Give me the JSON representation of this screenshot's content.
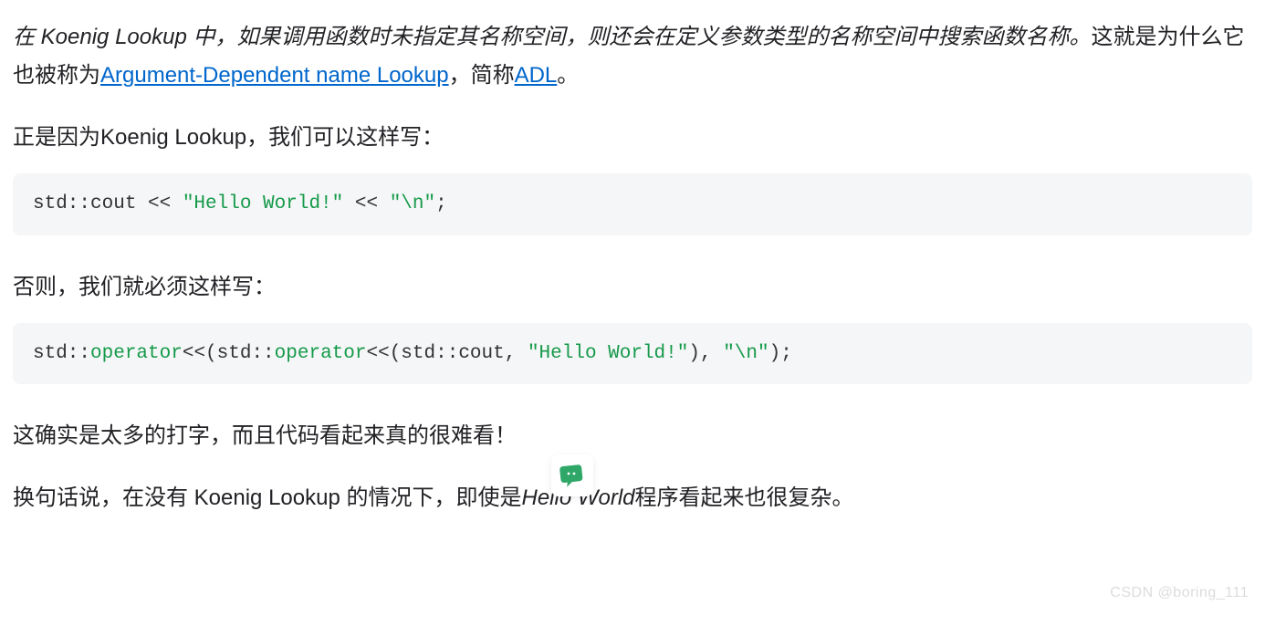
{
  "para1": {
    "seg1_italic": "在 Koenig Lookup 中，如果调用函数时未指定其名称空间，则还会在定义参数类型的名称空间中搜索函数名称。",
    "seg2": "这就是为什么它也被称为",
    "link1": "Argument-Dependent name Lookup",
    "seg3": "，简称",
    "link2": "ADL",
    "seg4": "。"
  },
  "para2": "正是因为Koenig Lookup，我们可以这样写：",
  "code1": {
    "t1": "std::cout << ",
    "s1": "\"Hello World!\"",
    "t2": " << ",
    "s2": "\"\\n\"",
    "t3": ";"
  },
  "para3": "否则，我们就必须这样写：",
  "code2": {
    "t1": "std::",
    "k1": "operator",
    "t2": "<<(std::",
    "k2": "operator",
    "t3": "<<(std::cout, ",
    "s1": "\"Hello World!\"",
    "t4": "), ",
    "s2": "\"\\n\"",
    "t5": ");"
  },
  "para4": "这确实是太多的打字，而且代码看起来真的很难看！",
  "para5": {
    "seg1": "换句话说，在没有 Koenig Lookup 的情况下，即使是",
    "italic": "Hello World",
    "seg2": "程序看起来也很复杂。"
  },
  "watermark": "CSDN @boring_111"
}
